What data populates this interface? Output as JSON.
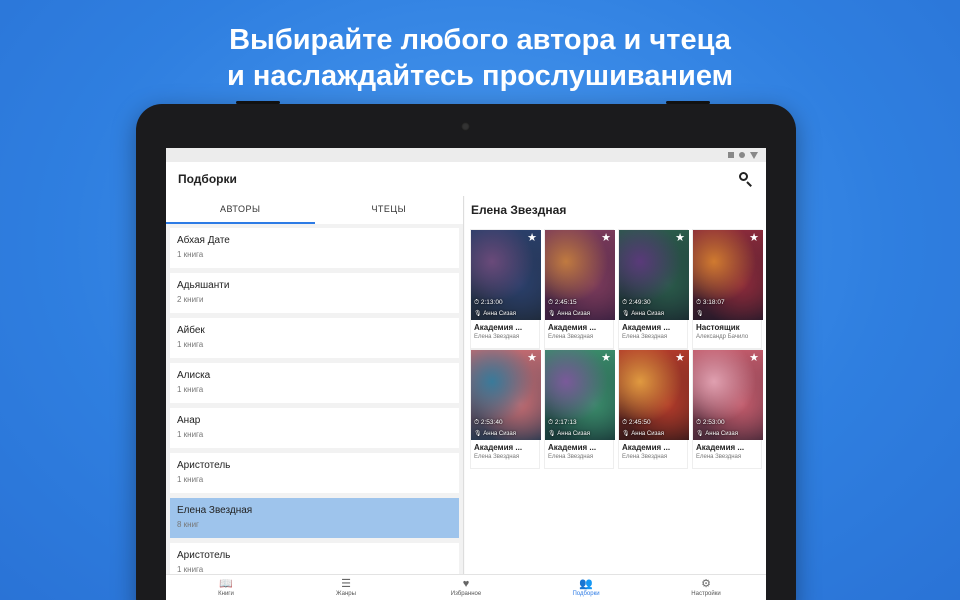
{
  "headline": {
    "line1": "Выбирайте любого автора и чтеца",
    "line2": "и наслаждайтесь прослушиванием"
  },
  "appbar": {
    "title": "Подборки"
  },
  "tabs": [
    {
      "label": "АВТОРЫ",
      "active": true
    },
    {
      "label": "ЧТЕЦЫ",
      "active": false
    }
  ],
  "authors": [
    {
      "name": "Абхая Дате",
      "count": "1 книга"
    },
    {
      "name": "Адьяшанти",
      "count": "2 книги"
    },
    {
      "name": "Айбек",
      "count": "1 книга"
    },
    {
      "name": "Алиска",
      "count": "1 книга"
    },
    {
      "name": "Анар",
      "count": "1 книга"
    },
    {
      "name": "Аристотель",
      "count": "1 книга"
    },
    {
      "name": "Елена Звездная",
      "count": "8 книг",
      "selected": true
    },
    {
      "name": "Аристотель",
      "count": "1 книга"
    }
  ],
  "selected_author": "Елена Звездная",
  "books": [
    {
      "title": "Академия ...",
      "author": "Елена Звездная",
      "duration": "2:13:00",
      "narrator": "Анна Сизая",
      "colors": [
        "#2a3f6a",
        "#6a4a7a",
        "#1f2a3a"
      ]
    },
    {
      "title": "Академия ...",
      "author": "Елена Звездная",
      "duration": "2:45:15",
      "narrator": "Анна Сизая",
      "colors": [
        "#7a3a5a",
        "#c07a40",
        "#3a2040"
      ]
    },
    {
      "title": "Академия ...",
      "author": "Елена Звездная",
      "duration": "2:49:30",
      "narrator": "Анна Сизая",
      "colors": [
        "#2a5a4a",
        "#5a3a7a",
        "#1a2a30"
      ]
    },
    {
      "title": "Настоящик",
      "author": "Александр Бачило",
      "duration": "3:18:07",
      "narrator": "",
      "colors": [
        "#8a2a3a",
        "#d07a30",
        "#2a1a2a"
      ]
    },
    {
      "title": "Академия ...",
      "author": "Елена Звездная",
      "duration": "2:53:40",
      "narrator": "Анна Сизая",
      "colors": [
        "#c06a70",
        "#3a7a9a",
        "#2a3a50"
      ]
    },
    {
      "title": "Академия ...",
      "author": "Елена Звездная",
      "duration": "2:17:13",
      "narrator": "Анна Сизая",
      "colors": [
        "#3a8a6a",
        "#7a5a9a",
        "#1a3a3a"
      ]
    },
    {
      "title": "Академия ...",
      "author": "Елена Звездная",
      "duration": "2:45:50",
      "narrator": "Анна Сизая",
      "colors": [
        "#b03a2a",
        "#e09a40",
        "#3a1a1a"
      ]
    },
    {
      "title": "Академия ...",
      "author": "Елена Звездная",
      "duration": "2:53:00",
      "narrator": "Анна Сизая",
      "colors": [
        "#c05a6a",
        "#e0a0b0",
        "#4a2a3a"
      ]
    }
  ],
  "nav": [
    {
      "label": "Книги",
      "icon": "book-open-icon",
      "glyph": "📖",
      "active": false
    },
    {
      "label": "Жанры",
      "icon": "list-icon",
      "glyph": "☰",
      "active": false
    },
    {
      "label": "Избранное",
      "icon": "heart-icon",
      "glyph": "♥",
      "active": false
    },
    {
      "label": "Подборки",
      "icon": "people-icon",
      "glyph": "👥",
      "active": true
    },
    {
      "label": "Настройки",
      "icon": "gear-icon",
      "glyph": "⚙",
      "active": false
    }
  ],
  "colors": {
    "accent": "#2d7be5",
    "selected_row": "#9ec4ec",
    "background": "#2f7fe0"
  }
}
